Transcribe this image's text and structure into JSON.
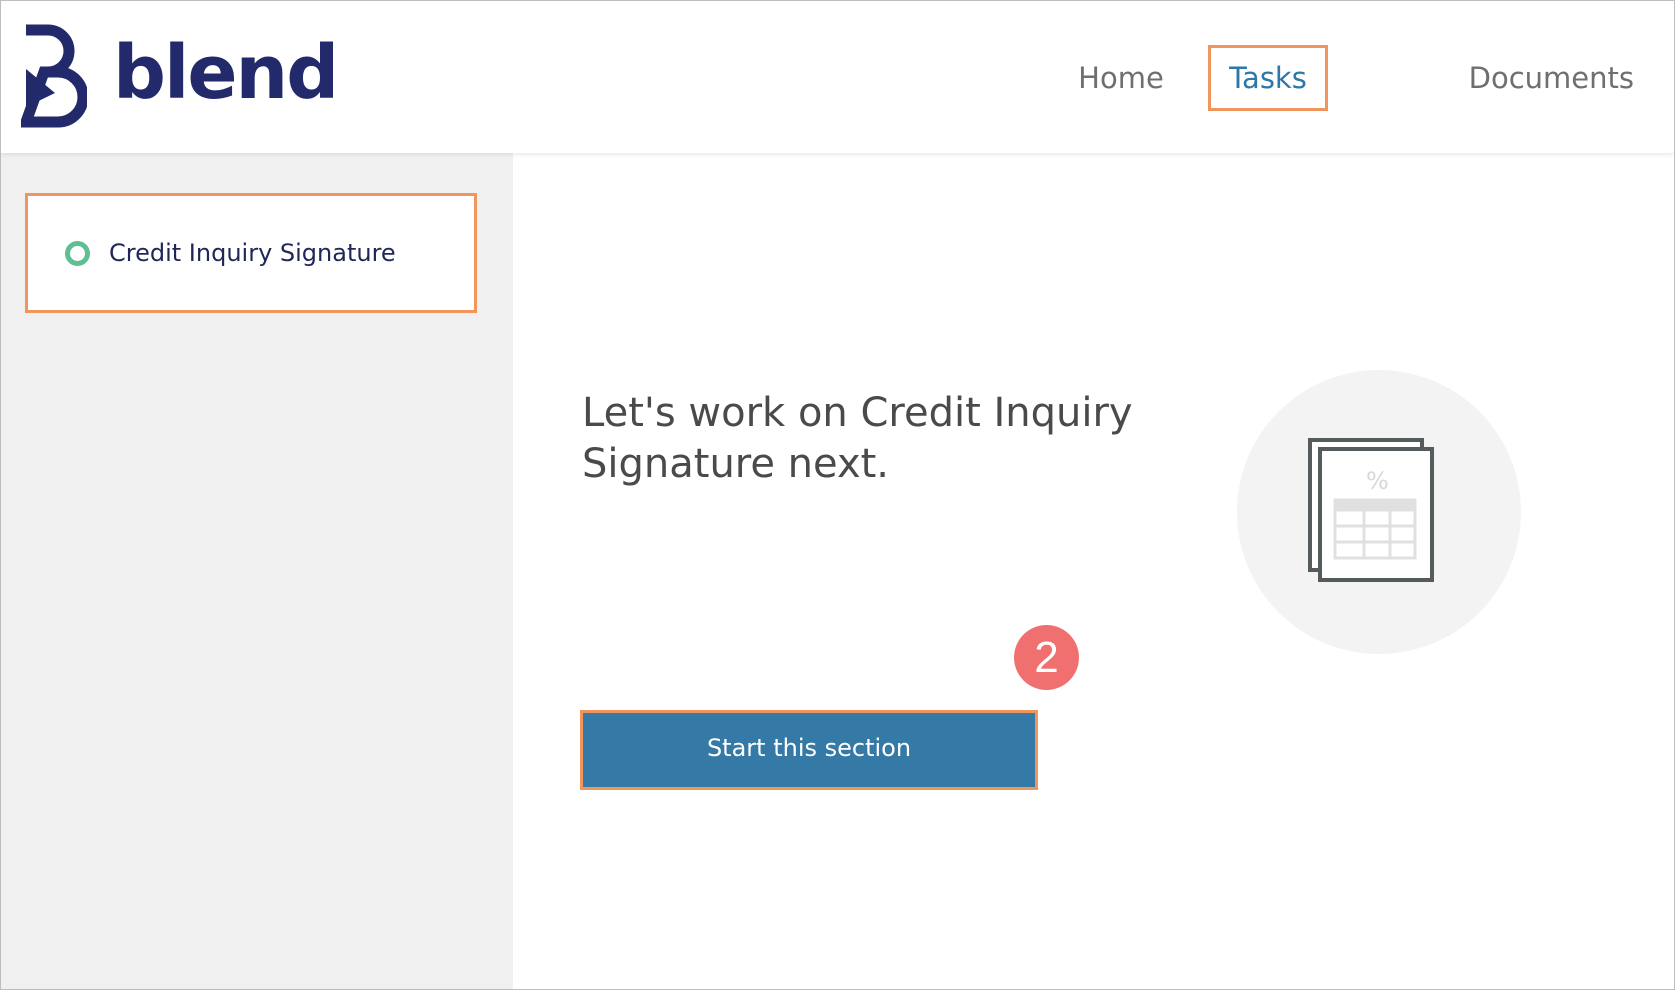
{
  "brand": {
    "name": "blend",
    "logo_icon": "blend-b-logo-icon",
    "color": "#232a6b"
  },
  "nav": {
    "items": [
      {
        "label": "Home",
        "active": false
      },
      {
        "label": "Tasks",
        "active": true
      },
      {
        "label": "Documents",
        "active": false
      }
    ],
    "active_color": "#2c78a8"
  },
  "sidebar": {
    "tasks": [
      {
        "label": "Credit Inquiry Signature",
        "status_icon": "circle-outline-icon",
        "status_color": "#5fbf93"
      }
    ]
  },
  "main": {
    "heading": "Let's work on Credit Inquiry Signature next.",
    "illustration_icon": "document-percent-table-icon",
    "step_badge": "2",
    "start_button_label": "Start this section",
    "button_color": "#3579a6"
  },
  "highlight_color": "#f0955b"
}
